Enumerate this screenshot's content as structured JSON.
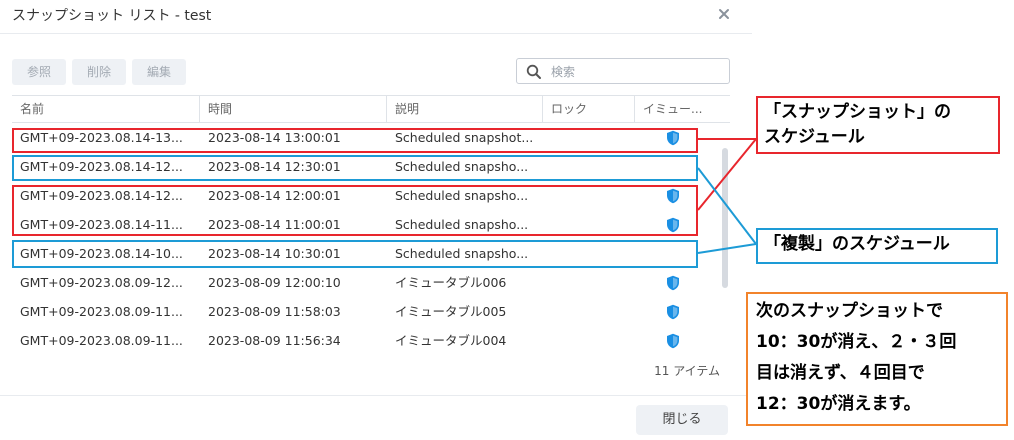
{
  "dialog": {
    "title": "スナップショット リスト - test",
    "toolbar": {
      "btn_view": "参照",
      "btn_delete": "削除",
      "btn_edit": "編集"
    },
    "search": {
      "placeholder": "検索"
    },
    "columns": [
      "名前",
      "時間",
      "説明",
      "ロック",
      "イミュー..."
    ],
    "rows": [
      {
        "name": "GMT+09-2023.08.14-13...",
        "time": "2023-08-14 13:00:01",
        "desc": "Scheduled snapshot...",
        "immutable": true
      },
      {
        "name": "GMT+09-2023.08.14-12...",
        "time": "2023-08-14 12:30:01",
        "desc": "Scheduled snapsho...",
        "immutable": false
      },
      {
        "name": "GMT+09-2023.08.14-12...",
        "time": "2023-08-14 12:00:01",
        "desc": "Scheduled snapsho...",
        "immutable": true
      },
      {
        "name": "GMT+09-2023.08.14-11...",
        "time": "2023-08-14 11:00:01",
        "desc": "Scheduled snapsho...",
        "immutable": true
      },
      {
        "name": "GMT+09-2023.08.14-10...",
        "time": "2023-08-14 10:30:01",
        "desc": "Scheduled snapsho...",
        "immutable": false
      },
      {
        "name": "GMT+09-2023.08.09-12...",
        "time": "2023-08-09 12:00:10",
        "desc": "イミュータブル006",
        "immutable": true
      },
      {
        "name": "GMT+09-2023.08.09-11...",
        "time": "2023-08-09 11:58:03",
        "desc": "イミュータブル005",
        "immutable": true
      },
      {
        "name": "GMT+09-2023.08.09-11...",
        "time": "2023-08-09 11:56:34",
        "desc": "イミュータブル004",
        "immutable": true
      }
    ],
    "item_count": "11 アイテム",
    "close_label": "閉じる"
  },
  "annotations": {
    "snapshot_schedule": [
      "「スナップショット」の",
      "スケジュール"
    ],
    "replication_schedule": "「複製」のスケジュール",
    "note": [
      "次のスナップショットで",
      "10：30が消え、２・３回",
      "目は消えず、４回目で",
      "12：30が消えます。"
    ]
  },
  "colors": {
    "red": "#e8262d",
    "blue": "#1d9bd6",
    "orange": "#f2832b",
    "shield": "#1a8fe3"
  }
}
